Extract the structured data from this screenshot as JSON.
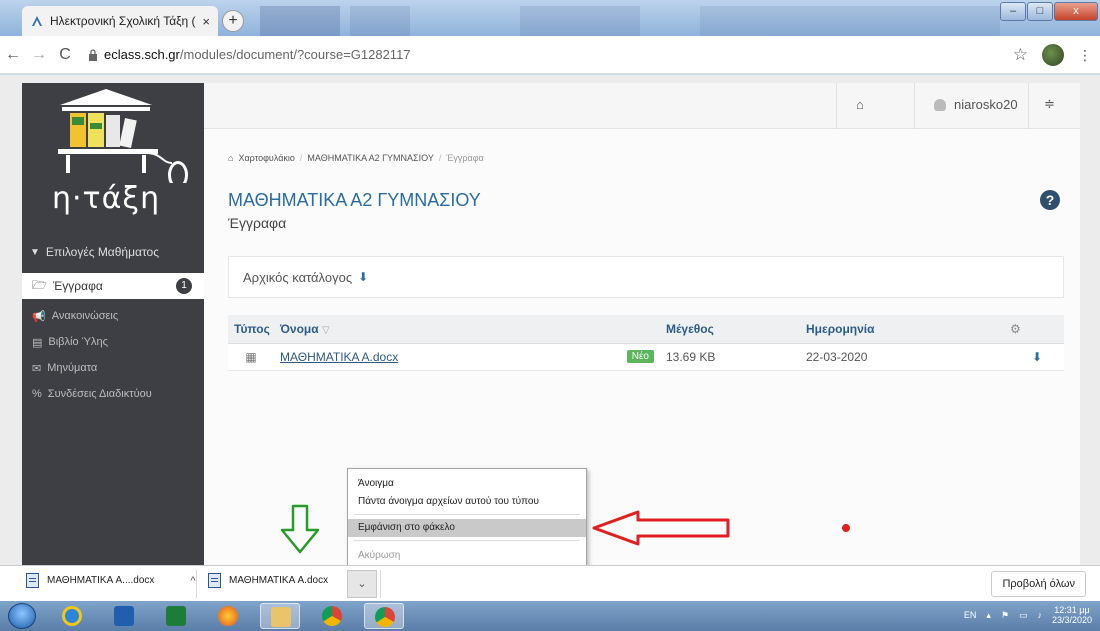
{
  "browser": {
    "tab_title": "Ηλεκτρονική Σχολική Τάξη (η-Τά",
    "tab_close": "×",
    "new_tab": "+",
    "url_host": "eclass.sch.gr",
    "url_path": "/modules/document/?course=G1282117",
    "window_controls": {
      "min": "–",
      "max": "□",
      "close": "x"
    }
  },
  "sidebar": {
    "logo_text": "η·τάξη",
    "section_label": "Επιλογές Μαθήματος",
    "items": [
      {
        "label": "Έγγραφα",
        "badge": "1",
        "icon": "folder-open-icon",
        "active": true
      },
      {
        "label": "Ανακοινώσεις",
        "icon": "megaphone-icon"
      },
      {
        "label": "Βιβλίο Ύλης",
        "icon": "calendar-icon"
      },
      {
        "label": "Μηνύματα",
        "icon": "envelope-icon"
      },
      {
        "label": "Συνδέσεις Διαδικτύου",
        "icon": "link-icon"
      }
    ]
  },
  "topnav": {
    "username": "niarosko20"
  },
  "breadcrumb": [
    "Χαρτοφυλάκιο",
    "ΜΑΘΗΜΑΤΙΚΑ Α2 ΓΥΜΝΑΣΙΟΥ",
    "Έγγραφα"
  ],
  "course": {
    "title": "ΜΑΘΗΜΑΤΙΚΑ Α2 ΓΥΜΝΑΣΙΟΥ",
    "subtitle": "Έγγραφα"
  },
  "directory": {
    "label": "Αρχικός κατάλογος"
  },
  "table": {
    "headers": {
      "type": "Τύπος",
      "name": "Όνομα",
      "size": "Μέγεθος",
      "date": "Ημερομηνία"
    },
    "rows": [
      {
        "name": "ΜΑΘΗΜΑΤΙΚΑ Α.docx",
        "badge": "Νέο",
        "size": "13.69 KB",
        "date": "22-03-2020"
      }
    ]
  },
  "context_menu": {
    "items": [
      "Άνοιγμα",
      "Πάντα άνοιγμα αρχείων αυτού του τύπου",
      "Εμφάνιση στο φάκελο",
      "Ακύρωση"
    ],
    "highlighted_index": 2
  },
  "downloads": {
    "items": [
      "ΜΑΘΗΜΑΤΙΚΑ A....docx",
      "ΜΑΘΗΜΑΤΙΚΑ A.docx"
    ],
    "show_all": "Προβολή όλων"
  },
  "taskbar": {
    "lang": "EN",
    "time": "12:31 μμ",
    "date": "23/3/2020"
  },
  "colors": {
    "accent": "#2b6ca3",
    "sidebar_bg": "#3d3f45",
    "annotation_red": "#e02020",
    "annotation_green": "#2a9a2a",
    "new_badge": "#5bb65b"
  }
}
